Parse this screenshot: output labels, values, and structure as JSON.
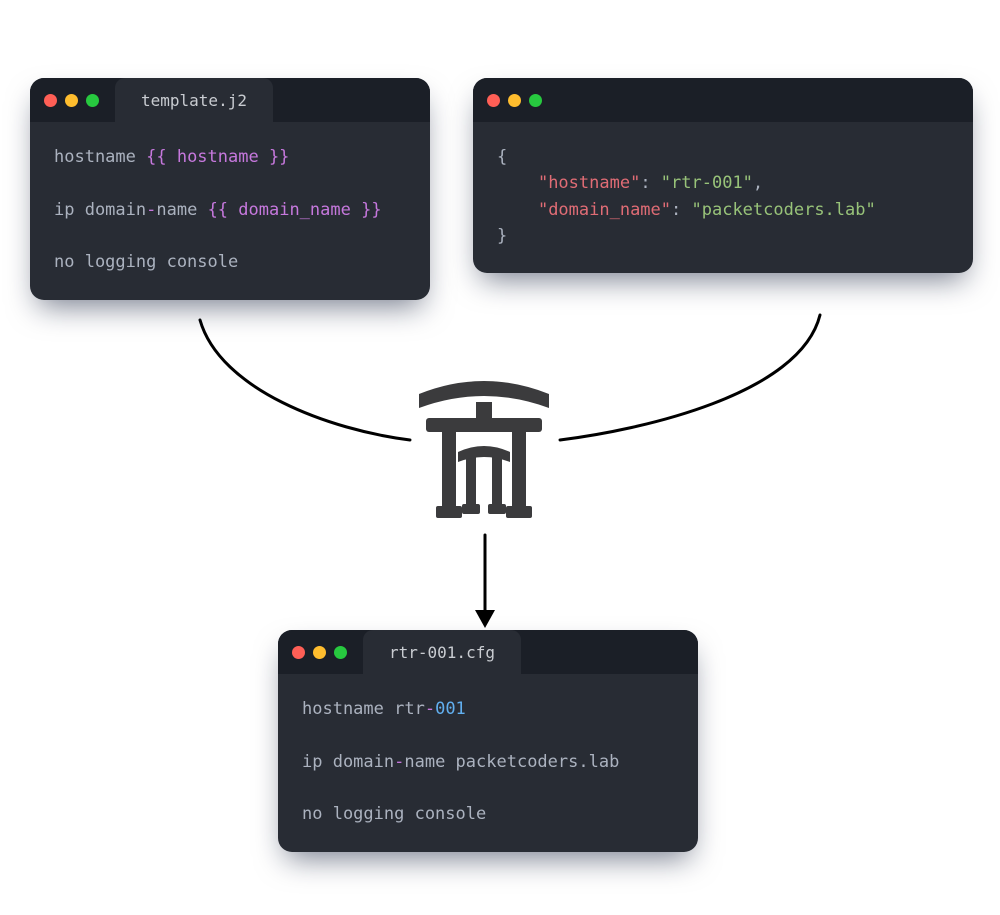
{
  "windows": {
    "template": {
      "tab_title": "template.j2",
      "lines": {
        "l1_a": "hostname ",
        "l1_b": "{{ hostname }}",
        "l2_a": "ip domain",
        "l2_dash": "-",
        "l2_b": "name ",
        "l2_c": "{{ domain_name }}",
        "l3": "no logging console"
      }
    },
    "data": {
      "lines": {
        "open": "{",
        "k1": "\"hostname\"",
        "v1": "\"rtr-001\"",
        "k2": "\"domain_name\"",
        "v2": "\"packetcoders.lab\"",
        "close": "}"
      }
    },
    "output": {
      "tab_title": "rtr-001.cfg",
      "lines": {
        "l1_a": "hostname rtr",
        "l1_dash": "-",
        "l1_b": "001",
        "l2_a": "ip domain",
        "l2_dash": "-",
        "l2_b": "name packetcoders.lab",
        "l3": "no logging console"
      }
    }
  },
  "logo": {
    "name": "jinja-torii-icon"
  }
}
